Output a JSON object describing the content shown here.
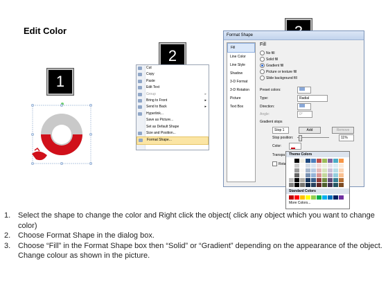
{
  "title": "Edit Color",
  "steps": [
    "1",
    "2",
    "3"
  ],
  "context_menu": {
    "items": [
      {
        "label": "Cut",
        "icon": "scissors-icon",
        "disabled": false
      },
      {
        "label": "Copy",
        "icon": "copy-icon",
        "disabled": false
      },
      {
        "label": "Paste",
        "icon": "paste-icon",
        "disabled": false
      },
      {
        "label": "Edit Text",
        "icon": "edit-text-icon",
        "disabled": false
      },
      {
        "label": "Group",
        "icon": "group-icon",
        "disabled": true,
        "submenu": true
      },
      {
        "label": "Bring to Front",
        "icon": "bring-front-icon",
        "disabled": false,
        "submenu": true
      },
      {
        "label": "Send to Back",
        "icon": "send-back-icon",
        "disabled": false,
        "submenu": true
      },
      {
        "label": "Hyperlink...",
        "icon": "hyperlink-icon",
        "disabled": false
      },
      {
        "label": "Save as Picture...",
        "icon": "",
        "disabled": false
      },
      {
        "label": "Set as Default Shape",
        "icon": "",
        "disabled": false
      },
      {
        "label": "Size and Position...",
        "icon": "size-icon",
        "disabled": false
      },
      {
        "label": "Format Shape...",
        "icon": "format-shape-icon",
        "disabled": false,
        "highlighted": true
      }
    ]
  },
  "dialog": {
    "title": "Format Shape",
    "nav": [
      "Fill",
      "Line Color",
      "Line Style",
      "Shadow",
      "3-D Format",
      "3-D Rotation",
      "Picture",
      "Text Box"
    ],
    "selected_nav": "Fill",
    "heading": "Fill",
    "options": [
      "No fill",
      "Solid fill",
      "Gradient fill",
      "Picture or texture fill",
      "Slide background fill"
    ],
    "selected_option": "Gradient fill",
    "preset_label": "Preset colors:",
    "type_label": "Type:",
    "type_value": "Radial",
    "direction_label": "Direction:",
    "angle_label": "Angle:",
    "angle_value": "0°",
    "stops_label": "Gradient stops",
    "stop_value": "Stop 1",
    "add_label": "Add",
    "remove_label": "Remove",
    "stop_position_label": "Stop position:",
    "stop_position_value": "11%",
    "color_label": "Color:",
    "transparency_label": "Transpa",
    "rotate_label": "Rotate"
  },
  "palette": {
    "theme_label": "Theme Colors",
    "standard_label": "Standard Colors",
    "more_label": "More Colors...",
    "theme_top": [
      "#ffffff",
      "#000000",
      "#eeece1",
      "#1f497d",
      "#4f81bd",
      "#c0504d",
      "#9bbb59",
      "#8064a2",
      "#4bacc6",
      "#f79646"
    ],
    "standard": [
      "#c00000",
      "#ff0000",
      "#ffc000",
      "#ffff00",
      "#92d050",
      "#00b050",
      "#00b0f0",
      "#0070c0",
      "#002060",
      "#7030a0"
    ]
  },
  "instructions": [
    {
      "n": "1.",
      "text": "Select the shape to change the color and Right click the object( click any object which you want to change color)"
    },
    {
      "n": "2.",
      "text": "Choose Format Shape in the dialog box."
    },
    {
      "n": "3.",
      "text": "Choose “Fill” in the Format Shape box then “Solid” or “Gradient” depending on the appearance of the object. Change colour as shown in the picture."
    }
  ]
}
